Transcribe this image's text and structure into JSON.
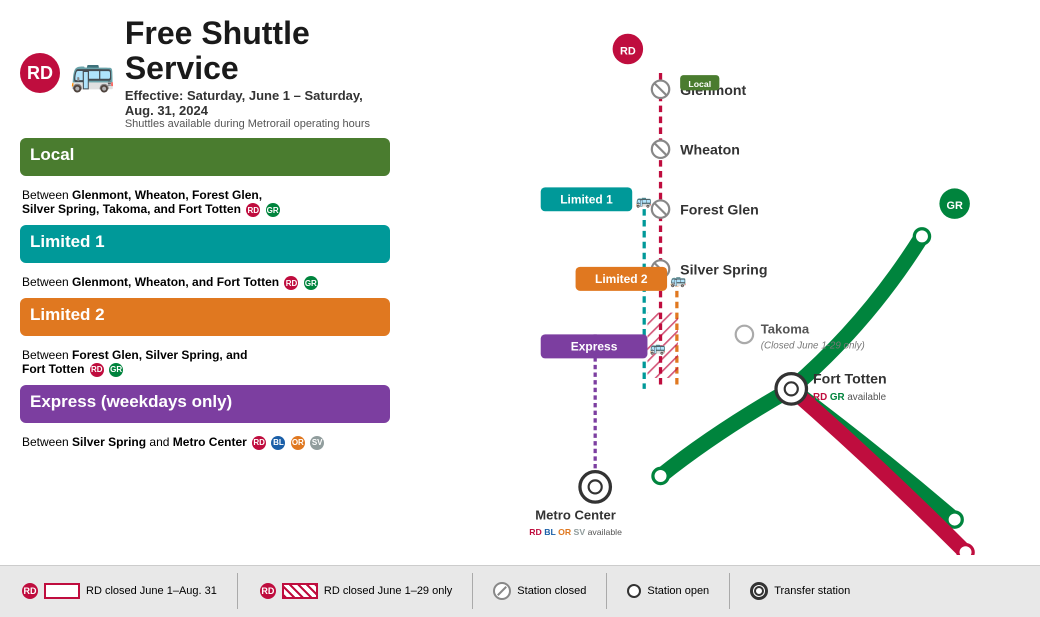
{
  "header": {
    "rd_label": "RD",
    "title": "Free Shuttle Service",
    "subtitle": "Effective: Saturday, June 1 – Saturday, Aug. 31, 2024",
    "sub2": "Shuttles available during Metrorail operating hours"
  },
  "services": [
    {
      "id": "local",
      "title": "Local",
      "desc_prefix": "Between ",
      "desc_bold": "Glenmont, Wheaton, Forest Glen, Silver Spring, Takoma, and Fort Totten",
      "badges": [
        "RD",
        "GR"
      ]
    },
    {
      "id": "limited1",
      "title": "Limited 1",
      "desc_prefix": "Between ",
      "desc_bold": "Glenmont, Wheaton, and Fort Totten",
      "badges": [
        "RD",
        "GR"
      ]
    },
    {
      "id": "limited2",
      "title": "Limited 2",
      "desc_prefix": "Between ",
      "desc_bold": "Forest Glen, Silver Spring, and Fort Totten",
      "badges": [
        "RD",
        "GR"
      ]
    },
    {
      "id": "express",
      "title": "Express (weekdays only)",
      "desc_prefix": "Between ",
      "desc_bold": "Silver Spring and Metro Center",
      "badges": [
        "RD",
        "BL",
        "OR",
        "SV"
      ]
    }
  ],
  "map": {
    "stations": [
      {
        "name": "Glenmont",
        "type": "closed"
      },
      {
        "name": "Wheaton",
        "type": "closed"
      },
      {
        "name": "Forest Glen",
        "type": "closed"
      },
      {
        "name": "Silver Spring",
        "type": "closed"
      },
      {
        "name": "Takoma",
        "type": "closed_partial",
        "note": "(Closed June 1-29 only)"
      },
      {
        "name": "Fort Totten",
        "type": "transfer",
        "note": "RD GR available"
      },
      {
        "name": "Metro Center",
        "type": "transfer",
        "note": "RD BL OR SV available"
      }
    ],
    "shuttle_labels": [
      {
        "id": "limited1",
        "label": "Limited 1"
      },
      {
        "id": "limited2",
        "label": "Limited 2"
      },
      {
        "id": "express",
        "label": "Express"
      }
    ]
  },
  "legend": {
    "item1_label": "RD closed June 1–Aug. 31",
    "item2_label": "RD closed June 1–29 only",
    "item3_label": "Station closed",
    "item4_label": "Station open",
    "item5_label": "Transfer station"
  }
}
